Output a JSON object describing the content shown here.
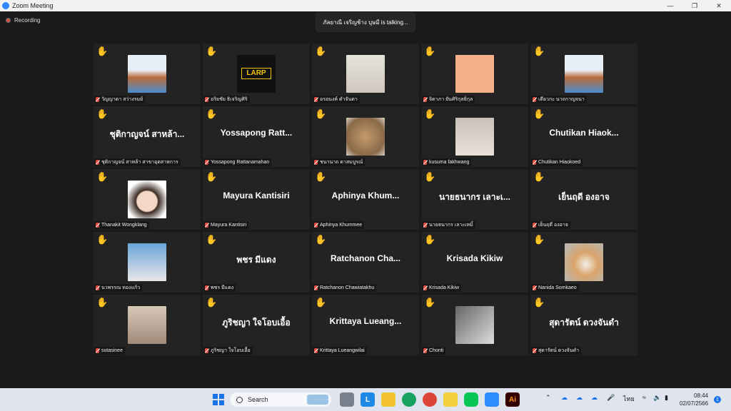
{
  "window": {
    "title": "Zoom Meeting"
  },
  "recording": {
    "label": "Recording"
  },
  "talking": {
    "text": "ภัลยาณี เจริญช้าง บุษมี is talking..."
  },
  "tiles": [
    {
      "label": "วัญญาดา สว่างรมย์",
      "type": "pic",
      "pic": "poster"
    },
    {
      "label": "อริยชัย ธิเจริญศิริ",
      "type": "pic",
      "pic": "larp",
      "pic_text": "LARP"
    },
    {
      "label": "อรอนงค์ ดำจันดา",
      "type": "pic",
      "pic": "mirror"
    },
    {
      "label": "จิดาภา ยันศิริกุลยิ่กุล",
      "type": "pic",
      "pic": "girl-drawing"
    },
    {
      "label": "เตียวกะ นาถกาญจนา",
      "type": "pic",
      "pic": "poster"
    },
    {
      "label": "ชุติกาญจน์ สาหล้า สาขาอุตสาหการ",
      "type": "name",
      "big": "ชุติกาญจน์ สาหล้า..."
    },
    {
      "label": "Yossapong Rattanamahan",
      "type": "name",
      "big": "Yossapong  Ratt..."
    },
    {
      "label": "ชนานาถ ดาสมบูรณ์",
      "type": "pic",
      "pic": "lion"
    },
    {
      "label": "kusuma fakhwang",
      "type": "pic",
      "pic": "girl-photo"
    },
    {
      "label": "Chutikan Hiaokoed",
      "type": "name",
      "big": "Chutikan  Hiaok..."
    },
    {
      "label": "Thanakit Wongklang",
      "type": "pic",
      "pic": "anime"
    },
    {
      "label": "Mayura Kantisiri",
      "type": "name",
      "big": "Mayura  Kantisiri"
    },
    {
      "label": "Aphinya Khummee",
      "type": "name",
      "big": "Aphinya  Khum..."
    },
    {
      "label": "นายธนากร เลาะเหมิ้",
      "type": "name",
      "big": "นายธนากร เลาะเ..."
    },
    {
      "label": "เย็นฤดี องอาจ",
      "type": "name",
      "big": "เย็นฤดี องอาจ"
    },
    {
      "label": "นวพรรณ ทองแก้ว",
      "type": "pic",
      "pic": "boy"
    },
    {
      "label": "พชร มีแดง",
      "type": "name",
      "big": "พชร มีแดง"
    },
    {
      "label": "Ratchanon Chawiatakhu",
      "type": "name",
      "big": "Ratchanon  Cha..."
    },
    {
      "label": "Krisada Kikiw",
      "type": "name",
      "big": "Krisada  Kikiw"
    },
    {
      "label": "Nanida Somkaeo",
      "type": "pic",
      "pic": "cat"
    },
    {
      "label": "sutasinee",
      "type": "pic",
      "pic": "room"
    },
    {
      "label": "ภูริชญา ใจโอบเอื้อ",
      "type": "name",
      "big": "ภูริชญา ใจโอบเอื้อ"
    },
    {
      "label": "Krittaya Lueangwilai",
      "type": "name",
      "big": "Krittaya  Lueang..."
    },
    {
      "label": "Chonti",
      "type": "pic",
      "pic": "bw"
    },
    {
      "label": "สุดารัตน์ ดวงจันดำ",
      "type": "name",
      "big": "สุดารัตน์ ดวงจันดำ"
    }
  ],
  "taskbar": {
    "search_label": "Search",
    "lang": "ไทย",
    "time": "08:44",
    "date": "02/07/2566",
    "notifications": "1"
  }
}
